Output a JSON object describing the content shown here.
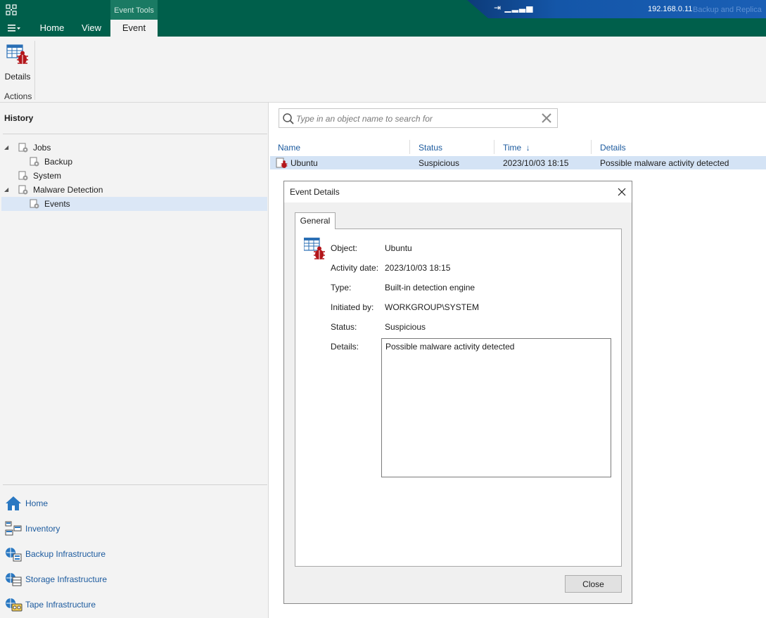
{
  "app": {
    "context_tab_group": "Event Tools",
    "tabs": [
      {
        "label": "Home"
      },
      {
        "label": "View"
      },
      {
        "label": "Event"
      }
    ],
    "server_ip": "192.168.0.11",
    "app_name_partial": "Backup and Replica"
  },
  "ribbon": {
    "details_label": "Details",
    "group_label": "Actions"
  },
  "sidebar": {
    "title": "History",
    "tree": [
      {
        "label": "Jobs"
      },
      {
        "label": "Backup"
      },
      {
        "label": "System"
      },
      {
        "label": "Malware Detection"
      },
      {
        "label": "Events"
      }
    ],
    "nav": [
      {
        "label": "Home"
      },
      {
        "label": "Inventory"
      },
      {
        "label": "Backup Infrastructure"
      },
      {
        "label": "Storage Infrastructure"
      },
      {
        "label": "Tape Infrastructure"
      }
    ]
  },
  "search": {
    "placeholder": "Type in an object name to search for"
  },
  "table": {
    "columns": [
      "Name",
      "Status",
      "Time",
      "Details"
    ],
    "sort_indicator": "↓",
    "rows": [
      {
        "name": "Ubuntu",
        "status": "Suspicious",
        "time": "2023/10/03 18:15",
        "details": "Possible malware activity detected"
      }
    ]
  },
  "dialog": {
    "title": "Event Details",
    "tab": "General",
    "fields": {
      "object_label": "Object:",
      "object_value": "Ubuntu",
      "activity_label": "Activity date:",
      "activity_value": "2023/10/03 18:15",
      "type_label": "Type:",
      "type_value": "Built-in detection engine",
      "initiated_label": "Initiated by:",
      "initiated_value": "WORKGROUP\\SYSTEM",
      "status_label": "Status:",
      "status_value": "Suspicious",
      "details_label": "Details:",
      "details_value": "Possible malware activity detected"
    },
    "close_button": "Close"
  },
  "colors": {
    "header_green": "#005f4b",
    "accent_blue": "#1b5a9e",
    "selection": "#d4e3f5",
    "bug_red": "#b3161b"
  }
}
